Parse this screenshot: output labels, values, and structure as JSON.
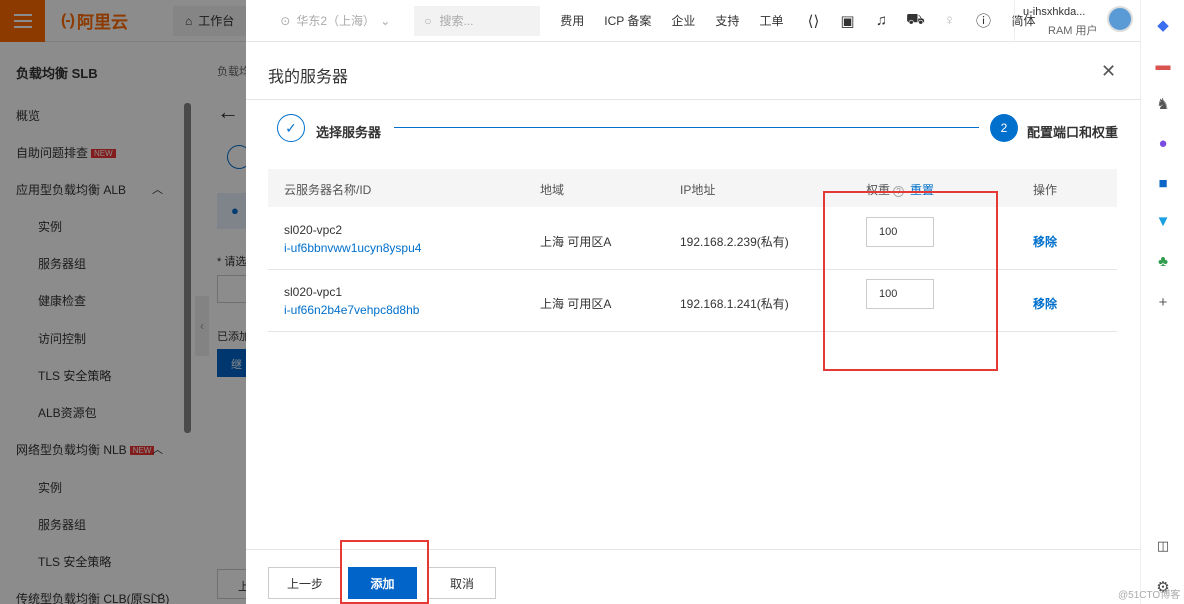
{
  "topbar": {
    "logo_bracket": "(-)",
    "logo_text": "阿里云",
    "workbench": "工作台",
    "region": "华东2（上海）",
    "search_placeholder": "搜索...",
    "links": [
      "费用",
      "ICP 备案",
      "企业",
      "支持",
      "工单"
    ],
    "lang": "简体",
    "username": "u-ihsxhkda...",
    "role": "RAM 用户"
  },
  "sidebar": {
    "title": "负载均衡 SLB",
    "items": [
      {
        "label": "概览"
      },
      {
        "label": "自助问题排查",
        "badge": "NEW"
      },
      {
        "label": "应用型负载均衡 ALB"
      },
      {
        "label": "实例"
      },
      {
        "label": "服务器组"
      },
      {
        "label": "健康检查"
      },
      {
        "label": "访问控制"
      },
      {
        "label": "TLS 安全策略"
      },
      {
        "label": "ALB资源包"
      },
      {
        "label": "网络型负载均衡 NLB",
        "badge": "NEW"
      },
      {
        "label": "实例"
      },
      {
        "label": "服务器组"
      },
      {
        "label": "TLS 安全策略"
      },
      {
        "label": "传统型负载均衡 CLB(原SLB)"
      }
    ]
  },
  "background": {
    "breadcrumb": "负载均",
    "hint_required": "* 请选",
    "added": "已添加",
    "btn": "继",
    "footer_btn": "上"
  },
  "dialog": {
    "title": "我的服务器",
    "steps": [
      {
        "number": "✓",
        "label": "选择服务器"
      },
      {
        "number": "2",
        "label": "配置端口和权重"
      }
    ],
    "columns": {
      "name": "云服务器名称/ID",
      "region": "地域",
      "ip": "IP地址",
      "weight": "权重",
      "reset": "重置",
      "action": "操作"
    },
    "rows": [
      {
        "name": "sl020-vpc2",
        "id": "i-uf6bbnvww1ucyn8yspu4",
        "region": "上海 可用区A",
        "ip": "192.168.2.239",
        "ip_type": "(私有)",
        "weight": "100",
        "action": "移除"
      },
      {
        "name": "sl020-vpc1",
        "id": "i-uf66n2b4e7vehpc8d8hb",
        "region": "上海 可用区A",
        "ip": "192.168.1.241",
        "ip_type": "(私有)",
        "weight": "100",
        "action": "移除"
      }
    ],
    "buttons": {
      "prev": "上一步",
      "add": "添加",
      "cancel": "取消"
    }
  },
  "watermark": "@51CTO博客",
  "colors": {
    "brand": "#ff6a00",
    "primary": "#0064c8",
    "link": "#0070cc",
    "highlight": "#e53935"
  }
}
